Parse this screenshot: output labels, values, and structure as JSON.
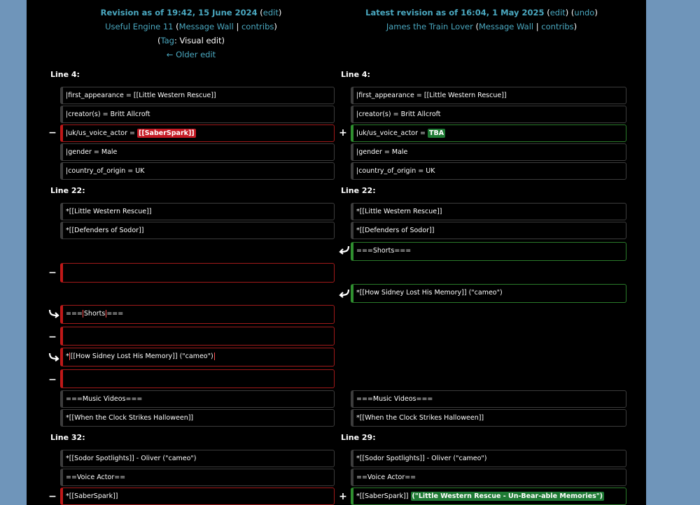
{
  "left_header": {
    "title": "Revision as of 19:42, 15 June 2024",
    "edit": "edit",
    "user": "Useful Engine 11",
    "message_wall": "Message Wall",
    "contribs": "contribs",
    "tag_label": "Tag",
    "tag_value": ": Visual edit)",
    "older_edit": "← Older edit"
  },
  "right_header": {
    "title": "Latest revision as of 16:04, 1 May 2025",
    "edit": "edit",
    "undo": "undo",
    "user": "James the Train Lover",
    "message_wall": "Message Wall",
    "contribs": "contribs"
  },
  "diff": {
    "l4": "Line 4:",
    "r4": "Line 4:",
    "l22": "Line 22:",
    "r22": "Line 22:",
    "l32": "Line 32:",
    "r29": "Line 29:",
    "minus": "−",
    "plus": "+",
    "first_appearance": "|first_appearance = [[Little Western Rescue]]",
    "creator": "|creator(s) = Britt Allcroft",
    "voice_actor_prefix": "|uk/us_voice_actor = ",
    "voice_actor_old": "[[SaberSpark]]",
    "voice_actor_new": "TBA",
    "gender": "|gender = Male",
    "country": "|country_of_origin = UK",
    "lwr": "*[[Little Western Rescue]]",
    "dos": "*[[Defenders of Sodor]]",
    "shorts": "===Shorts===",
    "shorts_a": "===",
    "shorts_b": "Shorts",
    "shorts_c": "===",
    "sidney": "*[[How Sidney Lost His Memory]] (\"cameo\")",
    "sidney_a": "*",
    "sidney_b": "[[How Sidney Lost His Memory]] (\"cameo\")",
    "music": "===Music Videos===",
    "clock": "*[[When the Clock Strikes Halloween]]",
    "spotlights": "*[[Sodor Spotlights]] - Oliver (\"cameo\")",
    "voice_hdr": "==Voice Actor==",
    "saber_old": "*[[SaberSpark]]",
    "saber_new_prefix": "*[[SaberSpark]] ",
    "saber_new_add": "(\"Little Western Rescue - Un-Bear-able Memories\")"
  },
  "colors": {
    "link": "#4aa8c0",
    "deleted": "#c51a24",
    "added": "#1e7a34"
  }
}
